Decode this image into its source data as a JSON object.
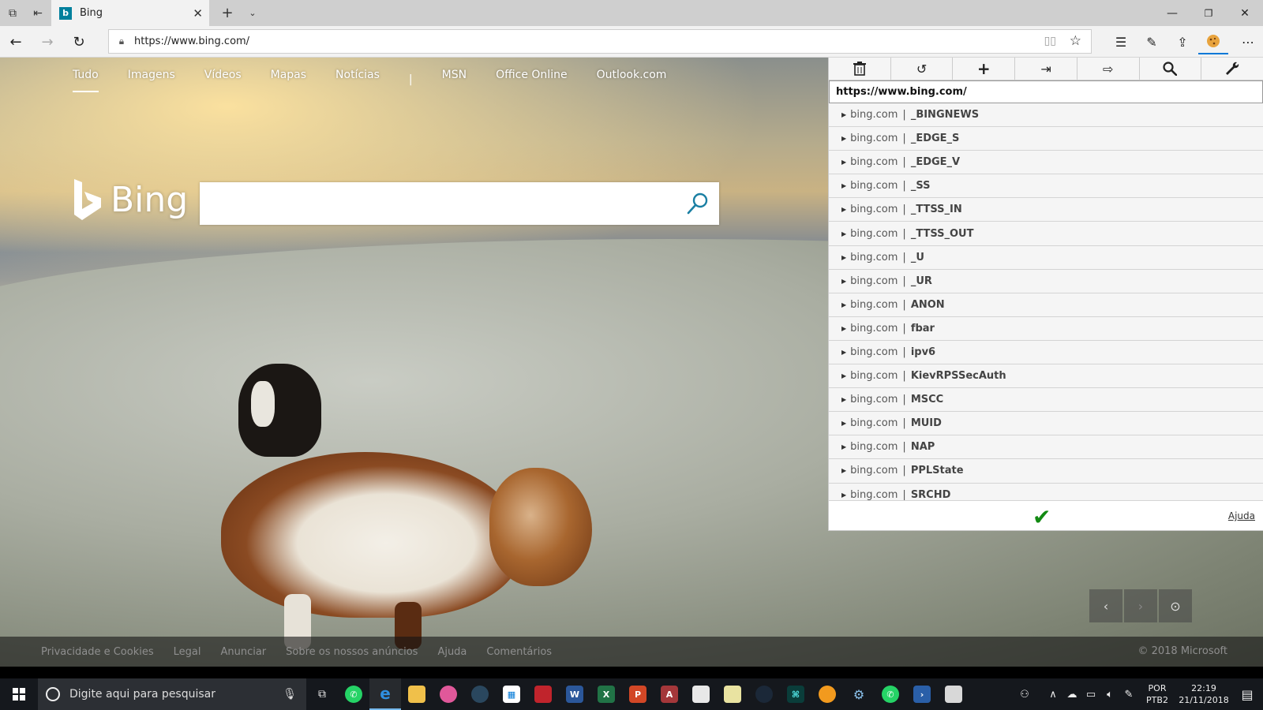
{
  "browser": {
    "tab_title": "Bing",
    "tab_favicon": "b",
    "url": "https://www.bing.com/"
  },
  "bing": {
    "nav": [
      "Tudo",
      "Imagens",
      "Vídeos",
      "Mapas",
      "Notícias",
      "MSN",
      "Office Online",
      "Outlook.com"
    ],
    "nav_separator": "|",
    "logo_text": "Bing",
    "search_value": ""
  },
  "footer": {
    "links": [
      "Privacidade e Cookies",
      "Legal",
      "Anunciar",
      "Sobre os nossos anúncios",
      "Ajuda",
      "Comentários"
    ],
    "copyright": "© 2018 Microsoft"
  },
  "cookie_panel": {
    "url": "https://www.bing.com/",
    "domain": "bing.com",
    "separator": "|",
    "cookies": [
      "_BINGNEWS",
      "_EDGE_S",
      "_EDGE_V",
      "_SS",
      "_TTSS_IN",
      "_TTSS_OUT",
      "_U",
      "_UR",
      "ANON",
      "fbar",
      "ipv6",
      "KievRPSSecAuth",
      "MSCC",
      "MUID",
      "NAP",
      "PPLState",
      "SRCHD"
    ],
    "help_label": "Ajuda",
    "toolbar_icons": [
      "trash-icon",
      "undo-icon",
      "plus-icon",
      "sign-in-icon",
      "sign-out-icon",
      "search-icon",
      "wrench-icon"
    ]
  },
  "taskbar": {
    "search_placeholder": "Digite aqui para pesquisar",
    "lang_top": "POR",
    "lang_bottom": "PTB2",
    "time": "22:19",
    "date": "21/11/2018"
  },
  "colors": {
    "accent": "#0078d7",
    "check_green": "#138a13",
    "bing_teal": "#00809d"
  }
}
